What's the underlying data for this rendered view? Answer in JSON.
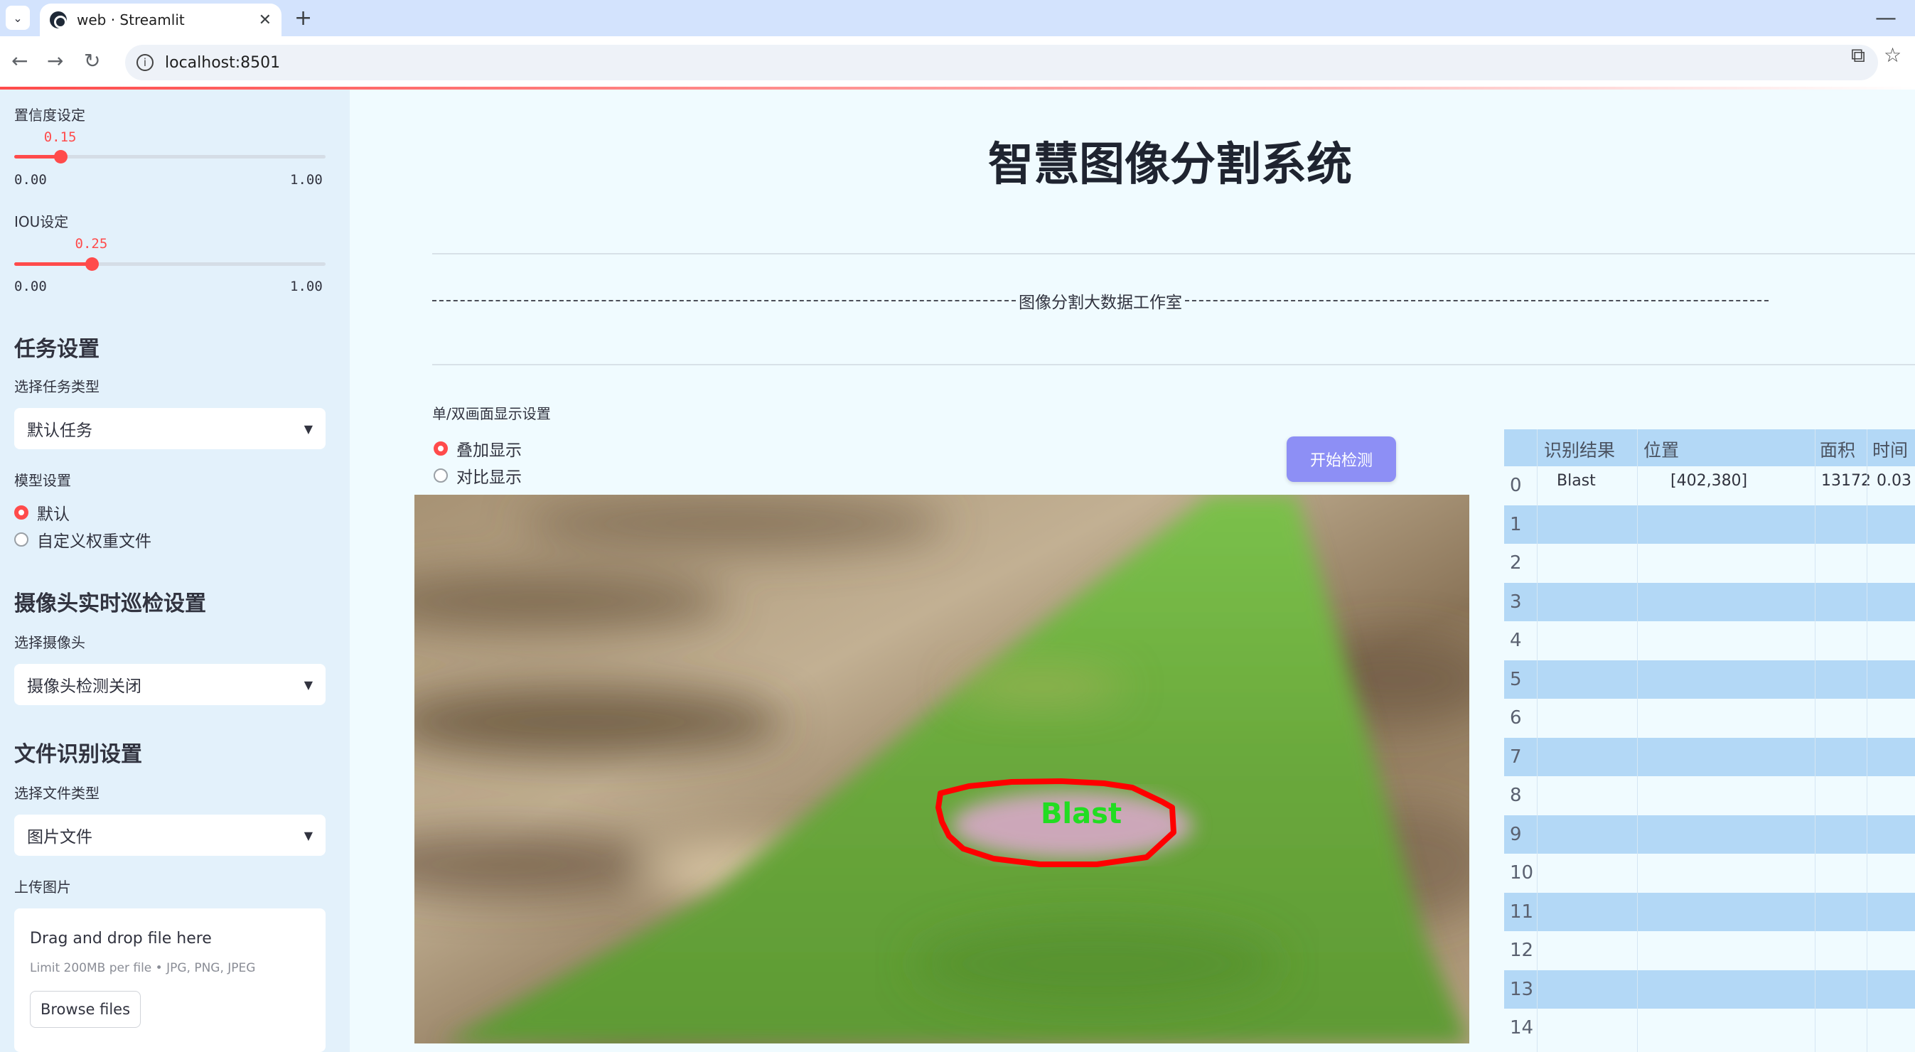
{
  "browser": {
    "tab_title": "web · Streamlit",
    "url": "localhost:8501"
  },
  "sidebar": {
    "confidence": {
      "label": "置信度设定",
      "value": "0.15",
      "min": "0.00",
      "max": "1.00",
      "fraction": 0.15
    },
    "iou": {
      "label": "IOU设定",
      "value": "0.25",
      "min": "0.00",
      "max": "1.00",
      "fraction": 0.25
    },
    "task_section": "任务设置",
    "task_type_label": "选择任务类型",
    "task_type_value": "默认任务",
    "model_label": "模型设置",
    "model_options": [
      "默认",
      "自定义权重文件"
    ],
    "model_selected": 0,
    "camera_section": "摄像头实时巡检设置",
    "camera_label": "选择摄像头",
    "camera_value": "摄像头检测关闭",
    "file_section": "文件识别设置",
    "file_type_label": "选择文件类型",
    "file_type_value": "图片文件",
    "upload_label": "上传图片",
    "upload_title": "Drag and drop file here",
    "upload_limit": "Limit 200MB per file • JPG, PNG, JPEG",
    "browse_label": "Browse files"
  },
  "main": {
    "title": "智慧图像分割系统",
    "banner": "图像分割大数据工作室",
    "display_label": "单/双画面显示设置",
    "display_options": [
      "叠加显示",
      "对比显示"
    ],
    "display_selected": 0,
    "start_button": "开始检测",
    "detection_label": "Blast"
  },
  "table": {
    "headers": [
      "识别结果",
      "位置",
      "面积",
      "时间"
    ],
    "rows": [
      {
        "index": "0",
        "result": "Blast",
        "position": "[402,380]",
        "area": "13172",
        "time": "0.03"
      },
      {
        "index": "1"
      },
      {
        "index": "2"
      },
      {
        "index": "3"
      },
      {
        "index": "4"
      },
      {
        "index": "5"
      },
      {
        "index": "6"
      },
      {
        "index": "7"
      },
      {
        "index": "8"
      },
      {
        "index": "9"
      },
      {
        "index": "10"
      },
      {
        "index": "11"
      },
      {
        "index": "12"
      },
      {
        "index": "13"
      },
      {
        "index": "14"
      }
    ]
  },
  "colors": {
    "accent": "#ff4b4b",
    "button": "#8d8ff5",
    "sidebar_bg": "#e3f1fb",
    "table_stripe": "#b3d8f6",
    "detection_outline": "#ff0000",
    "detection_text": "#22dd22"
  }
}
